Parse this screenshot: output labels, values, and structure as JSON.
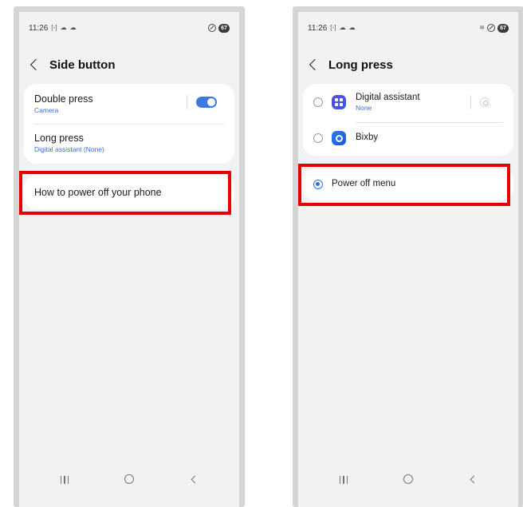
{
  "left_screen": {
    "status": {
      "time": "11:26",
      "icons": [
        "screenshot-icon",
        "cloud-icon",
        "cloud-icon"
      ],
      "battery": "67"
    },
    "title": "Side button",
    "double_press": {
      "title": "Double press",
      "subtitle": "Camera",
      "toggle_on": true
    },
    "long_press": {
      "title": "Long press",
      "subtitle": "Digital assistant (None)"
    },
    "power_off_help": {
      "title": "How to power off your phone"
    }
  },
  "right_screen": {
    "status": {
      "time": "11:26",
      "icons": [
        "screenshot-icon",
        "cloud-icon",
        "cloud-icon"
      ],
      "battery": "67"
    },
    "title": "Long press",
    "options": [
      {
        "title": "Digital assistant",
        "subtitle": "None",
        "selected": false,
        "icon": "digital-assistant-icon"
      },
      {
        "title": "Bixby",
        "selected": false,
        "icon": "bixby-icon"
      }
    ],
    "power_off_menu": {
      "title": "Power off menu",
      "selected": true
    }
  },
  "colors": {
    "accent": "#3d7ae0",
    "highlight": "#e60000",
    "background": "#f2f2f5",
    "card": "#ffffff"
  }
}
